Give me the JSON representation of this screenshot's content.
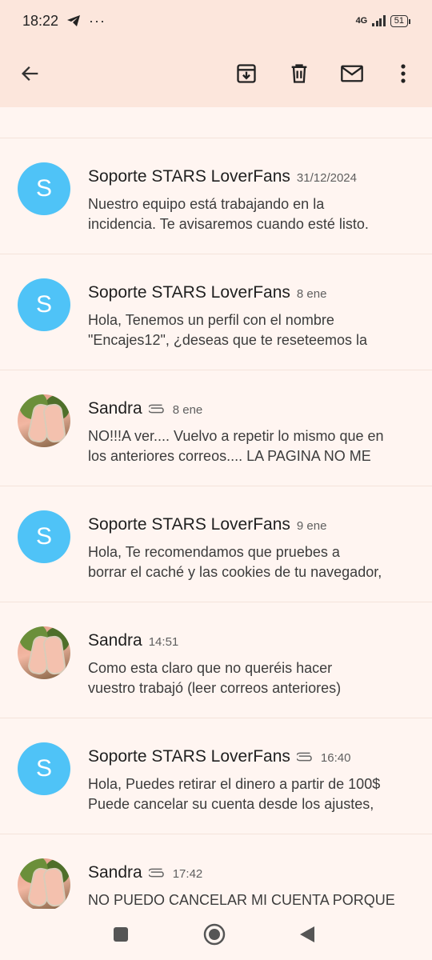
{
  "status_bar": {
    "time": "18:22",
    "network": "4G",
    "battery": "51",
    "icons": [
      "telegram-icon",
      "more-dots-icon",
      "signal-icon",
      "battery-icon"
    ]
  },
  "toolbar": {
    "icons": [
      "back-arrow-icon",
      "archive-icon",
      "delete-icon",
      "mark-unread-icon",
      "more-vert-icon"
    ]
  },
  "colors": {
    "avatar_blue": "#4fc3f7",
    "header_bg": "#fce6dc",
    "body_bg": "#fff5f1"
  },
  "messages": [
    {
      "avatar_letter": "S",
      "sender": "Soporte STARS LoverFans",
      "date": "31/12/2024",
      "attachment": false,
      "preview_1": "Nuestro equipo está trabajando en la",
      "preview_2": "incidencia. Te avisaremos cuando esté listo."
    },
    {
      "avatar_letter": "S",
      "sender": "Soporte STARS LoverFans",
      "date": "8 ene",
      "attachment": false,
      "preview_1": "Hola, Tenemos un perfil con el nombre",
      "preview_2": "\"Encajes12\", ¿deseas que te reseteemos la"
    },
    {
      "avatar_letter": "",
      "sender": "Sandra",
      "date": "8 ene",
      "attachment": true,
      "preview_1": "NO!!!A ver.... Vuelvo a repetir lo mismo que en",
      "preview_2": "los anteriores correos.... LA PAGINA NO ME"
    },
    {
      "avatar_letter": "S",
      "sender": "Soporte STARS LoverFans",
      "date": "9 ene",
      "attachment": false,
      "preview_1": "Hola, Te recomendamos que pruebes a",
      "preview_2": "borrar el caché y las cookies de tu navegador,"
    },
    {
      "avatar_letter": "",
      "sender": "Sandra",
      "date": "14:51",
      "attachment": false,
      "preview_1": "Como esta claro que no queréis hacer",
      "preview_2": "vuestro trabajó (leer correos anteriores)"
    },
    {
      "avatar_letter": "S",
      "sender": "Soporte STARS LoverFans",
      "date": "16:40",
      "attachment": true,
      "preview_1": "Hola, Puedes retirar el dinero a partir de 100$",
      "preview_2": "Puede cancelar su cuenta desde los ajustes,"
    },
    {
      "avatar_letter": "",
      "sender": "Sandra",
      "date": "17:42",
      "attachment": true,
      "preview_1": "NO PUEDO CANCELAR MI CUENTA PORQUE",
      "preview_2": ""
    }
  ],
  "nav_bar": {
    "icons": [
      "recents-square-icon",
      "home-circle-icon",
      "back-triangle-icon"
    ]
  }
}
